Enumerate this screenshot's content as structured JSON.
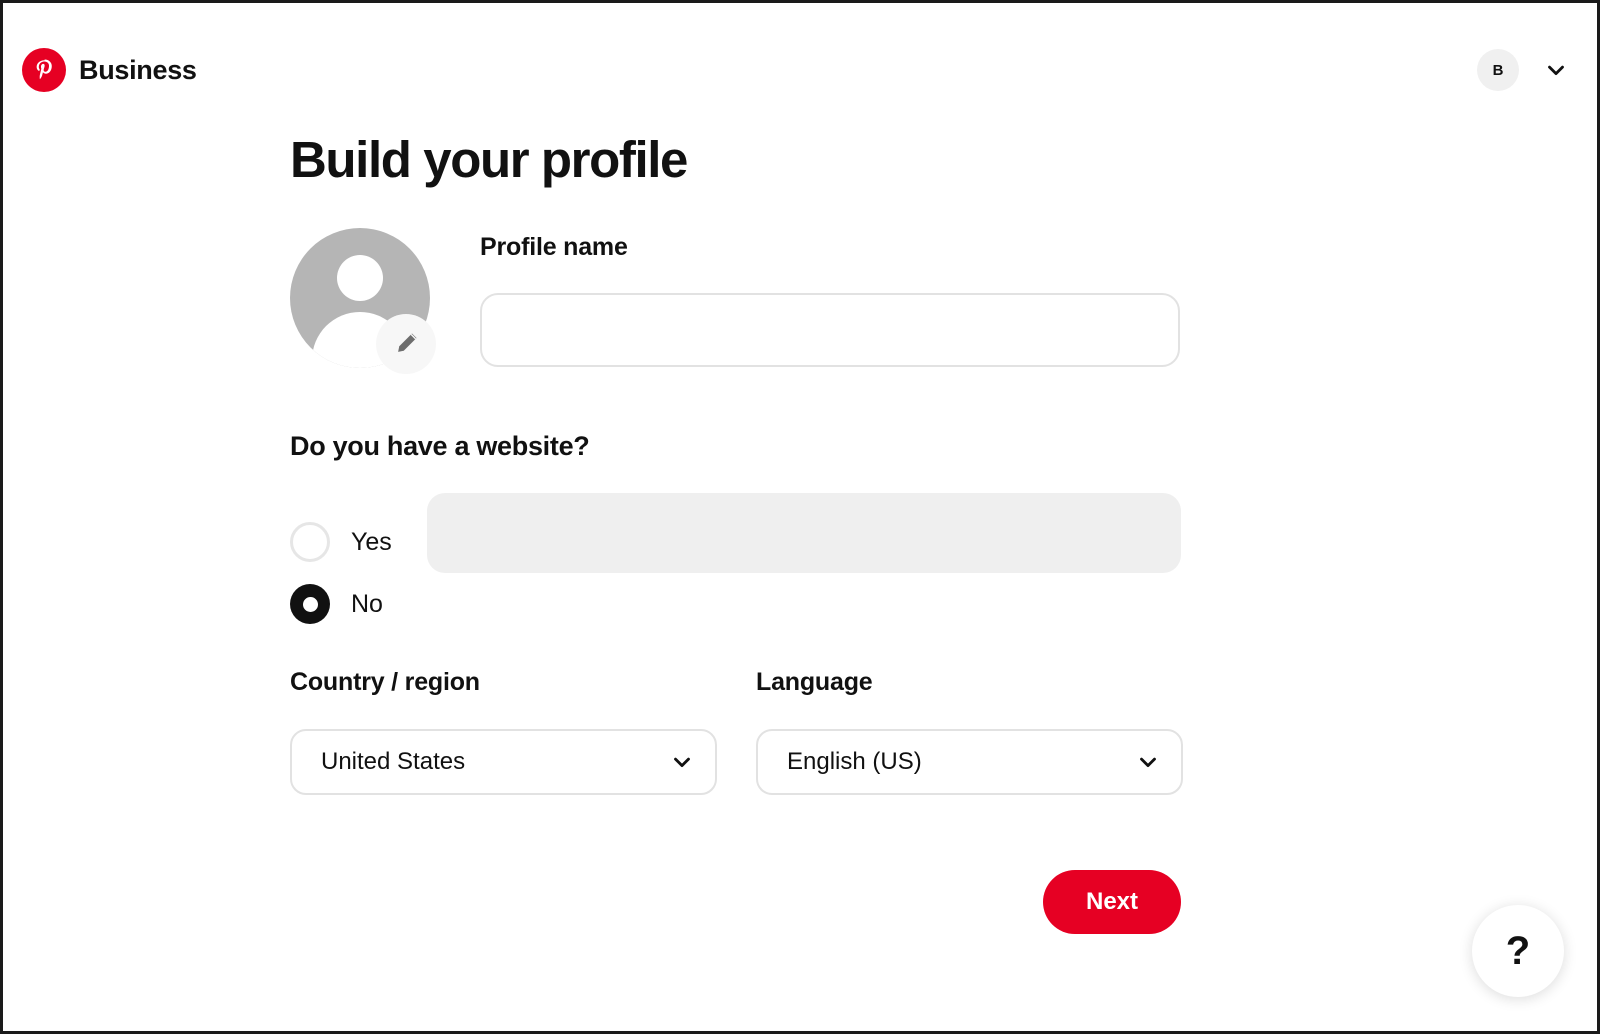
{
  "header": {
    "brand_name": "Business",
    "logo_icon": "pinterest-logo-icon",
    "account_initial": "B",
    "account_chevron_icon": "chevron-down-icon"
  },
  "page": {
    "title": "Build your profile"
  },
  "profile": {
    "avatar_icon": "person-placeholder-icon",
    "avatar_edit_icon": "pencil-edit-icon",
    "name_label": "Profile name",
    "name_value": "",
    "name_placeholder": ""
  },
  "website": {
    "question": "Do you have a website?",
    "options": [
      {
        "label": "Yes",
        "selected": false
      },
      {
        "label": "No",
        "selected": true
      }
    ],
    "input_value": "",
    "input_placeholder": "",
    "input_disabled": true
  },
  "locale": {
    "country_label": "Country / region",
    "country_value": "United States",
    "country_chevron_icon": "chevron-down-icon",
    "language_label": "Language",
    "language_value": "English (US)",
    "language_chevron_icon": "chevron-down-icon"
  },
  "actions": {
    "next_label": "Next",
    "help_label": "?"
  },
  "colors": {
    "brand_red": "#e60023",
    "text": "#111111",
    "border": "#e2e2e2",
    "disabled_bg": "#efefef",
    "avatar_gray": "#b5b5b5"
  }
}
